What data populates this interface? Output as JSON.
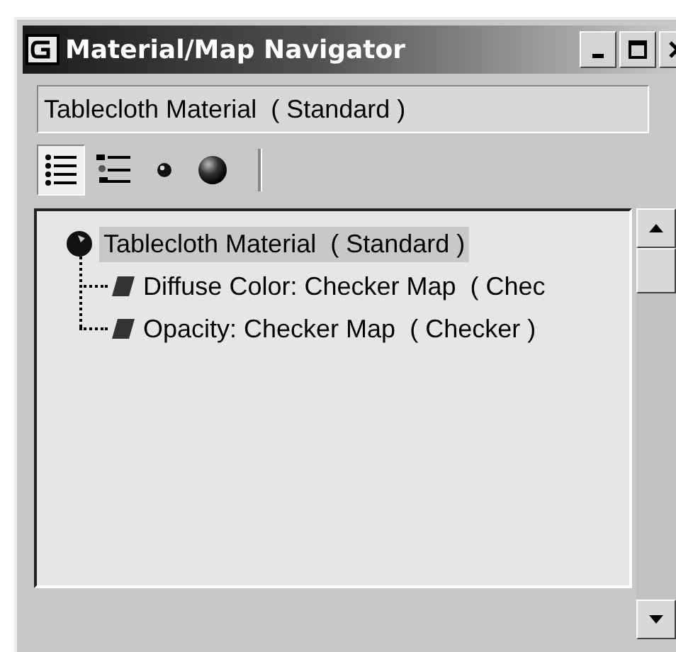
{
  "window": {
    "title": "Material/Map Navigator"
  },
  "name_field": {
    "value": "Tablecloth Material  ( Standard )"
  },
  "toolbar": [
    {
      "kind": "list",
      "selected": true
    },
    {
      "kind": "list-icons",
      "selected": false
    },
    {
      "kind": "small-sphere",
      "selected": false
    },
    {
      "kind": "large-sphere",
      "selected": false
    }
  ],
  "tree": [
    {
      "label": "Tablecloth Material  ( Standard )",
      "kind": "material",
      "selected": true,
      "children": [
        {
          "label": "Diffuse Color: Checker Map  ( Chec",
          "kind": "map",
          "selected": false
        },
        {
          "label": "Opacity: Checker Map  ( Checker )",
          "kind": "map",
          "selected": false
        }
      ]
    }
  ]
}
